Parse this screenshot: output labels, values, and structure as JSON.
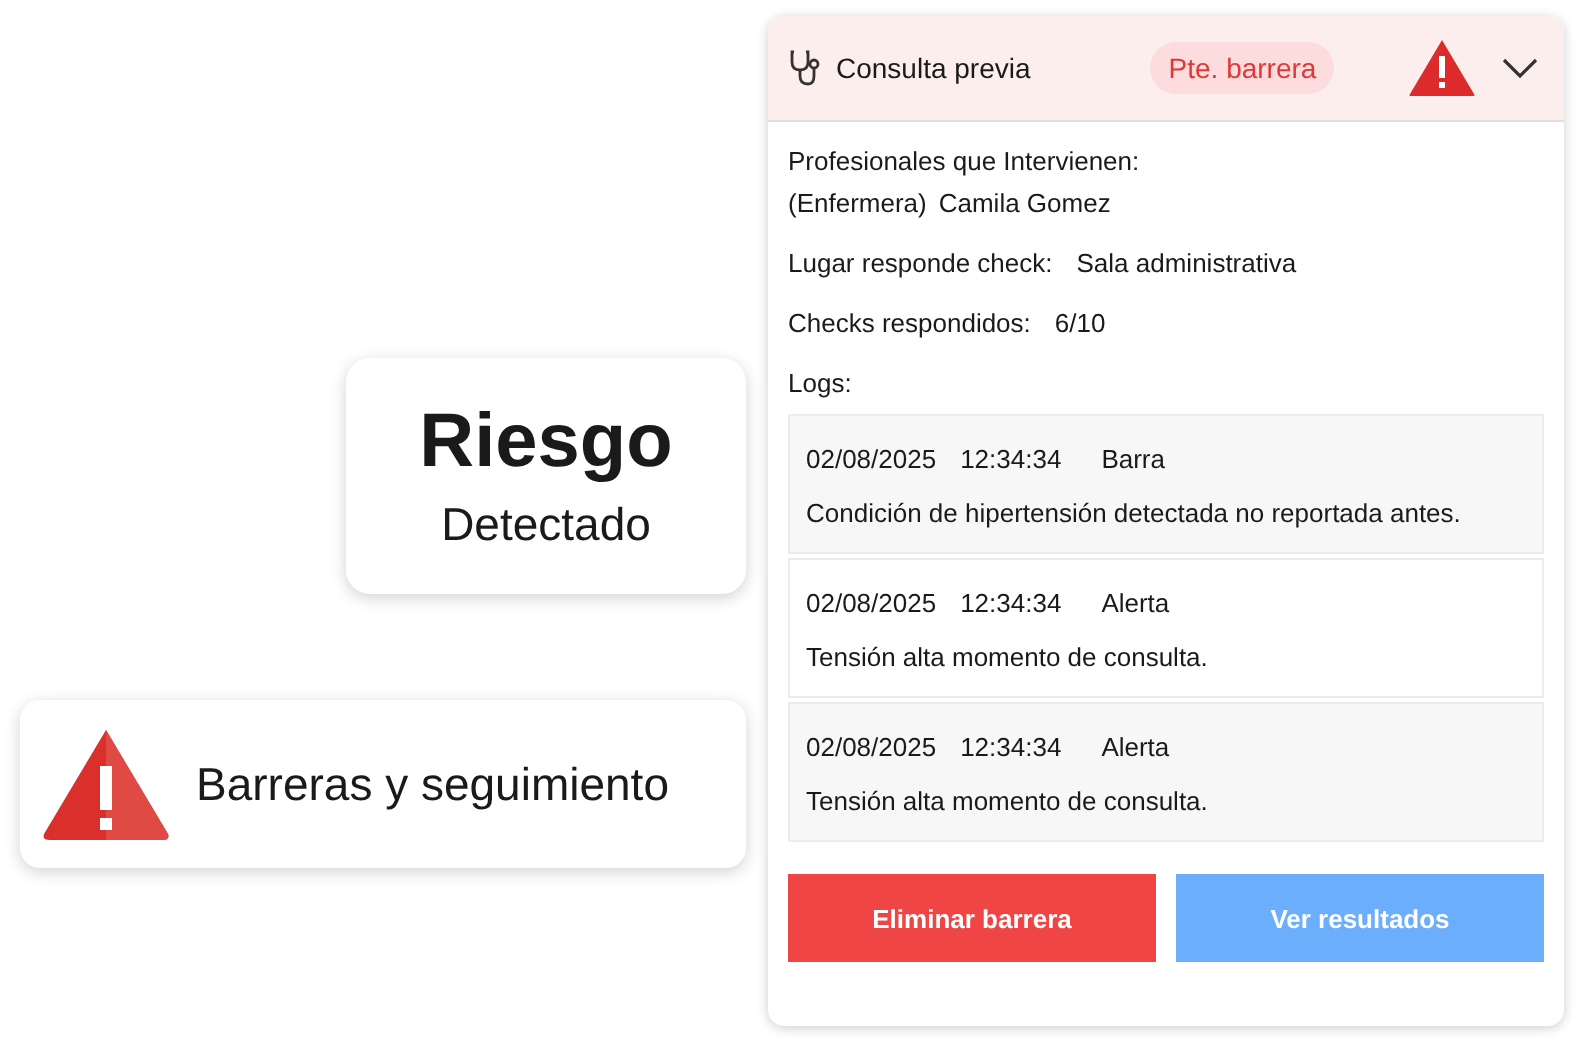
{
  "risk_card": {
    "title": "Riesgo",
    "subtitle": "Detectado"
  },
  "barriers_card": {
    "label": "Barreras y seguimiento"
  },
  "panel": {
    "title": "Consulta previa",
    "status_badge": "Pte. barrera",
    "expanded": true,
    "professionals_label": "Profesionales que Intervienen:",
    "professional_role": "(Enfermera)",
    "professional_name": "Camila Gomez",
    "fields": [
      {
        "label": "Lugar responde check:",
        "value": "Sala administrativa"
      },
      {
        "label": "Checks respondidos:",
        "value": "6/10"
      }
    ],
    "logs_label": "Logs:",
    "logs": [
      {
        "date": "02/08/2025",
        "time": "12:34:34",
        "type": "Barra",
        "message": "Condición de hipertensión detectada no reportada antes."
      },
      {
        "date": "02/08/2025",
        "time": "12:34:34",
        "type": "Alerta",
        "message": "Tensión alta momento de consulta."
      },
      {
        "date": "02/08/2025",
        "time": "12:34:34",
        "type": "Alerta",
        "message": "Tensión alta momento de consulta."
      }
    ],
    "buttons": [
      {
        "label": "Eliminar barrera",
        "kind": "danger"
      },
      {
        "label": "Ver resultados",
        "kind": "primary"
      }
    ]
  }
}
